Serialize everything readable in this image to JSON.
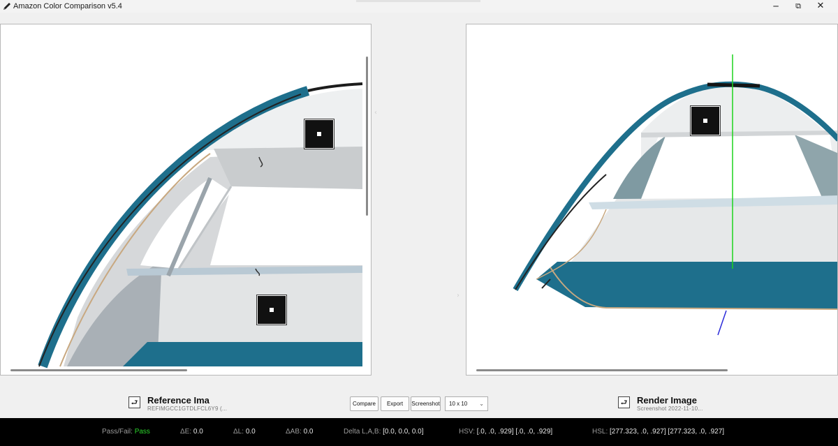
{
  "window": {
    "title": "Amazon Color Comparison v5.4",
    "minimize": "─",
    "maximize": "⧉",
    "close": "✕"
  },
  "reference": {
    "title": "Reference Ima",
    "subtitle": "REFIMGCC1GTDLFCL6Y9 (...",
    "swap_glyph": "⮐"
  },
  "render": {
    "title": "Render Image",
    "subtitle": "Screenshot 2022-11-10...",
    "swap_glyph": "⮐"
  },
  "toolbar": {
    "compare_label": "Compare",
    "export_label": "Export",
    "screenshot_label": "Screenshot",
    "grid_size": "10 x 10",
    "chevron": "⌄"
  },
  "status": {
    "pass_fail_label": "Pass/Fail:",
    "pass_fail_value": "Pass",
    "delta_e_label": "ΔE:",
    "delta_e_value": "0.0",
    "delta_l_label": "ΔL:",
    "delta_l_value": "0.0",
    "delta_ab_label": "ΔAB:",
    "delta_ab_value": "0.0",
    "delta_lab_label": "Delta L,A,B:",
    "delta_lab_value": "[0.0, 0.0, 0.0]",
    "hsv_label": "HSV:",
    "hsv_value": "[.0, .0, .929] [.0, .0, .929]",
    "hsl_label": "HSL:",
    "hsl_value": "[277.323, .0, .927] [277.323, .0, .927]"
  },
  "colors": {
    "accent_teal": "#1e6f8c",
    "pass_green": "#2bd62b",
    "status_bg": "#000000"
  },
  "icons": {
    "app": "pen-icon",
    "swap": "swap-icon"
  }
}
